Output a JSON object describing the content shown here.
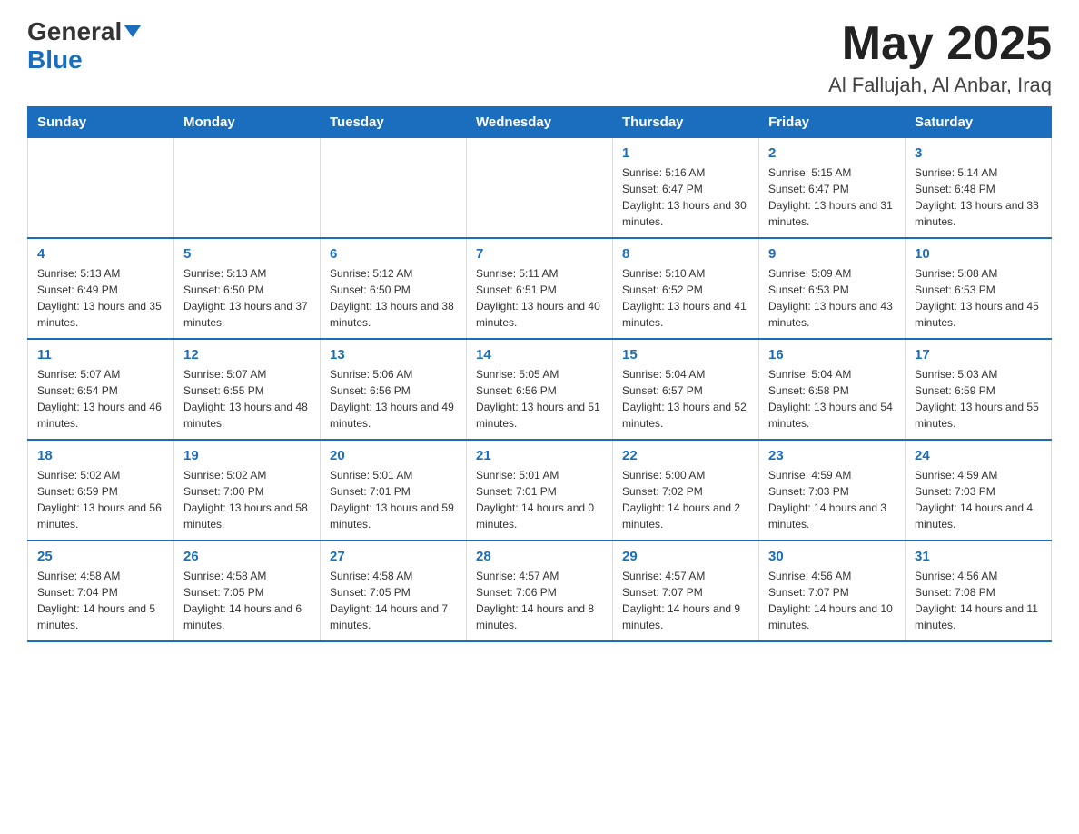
{
  "logo": {
    "text_general": "General",
    "text_blue": "Blue"
  },
  "title": {
    "month_year": "May 2025",
    "location": "Al Fallujah, Al Anbar, Iraq"
  },
  "days_of_week": [
    "Sunday",
    "Monday",
    "Tuesday",
    "Wednesday",
    "Thursday",
    "Friday",
    "Saturday"
  ],
  "weeks": [
    [
      {
        "day": "",
        "info": ""
      },
      {
        "day": "",
        "info": ""
      },
      {
        "day": "",
        "info": ""
      },
      {
        "day": "",
        "info": ""
      },
      {
        "day": "1",
        "info": "Sunrise: 5:16 AM\nSunset: 6:47 PM\nDaylight: 13 hours and 30 minutes."
      },
      {
        "day": "2",
        "info": "Sunrise: 5:15 AM\nSunset: 6:47 PM\nDaylight: 13 hours and 31 minutes."
      },
      {
        "day": "3",
        "info": "Sunrise: 5:14 AM\nSunset: 6:48 PM\nDaylight: 13 hours and 33 minutes."
      }
    ],
    [
      {
        "day": "4",
        "info": "Sunrise: 5:13 AM\nSunset: 6:49 PM\nDaylight: 13 hours and 35 minutes."
      },
      {
        "day": "5",
        "info": "Sunrise: 5:13 AM\nSunset: 6:50 PM\nDaylight: 13 hours and 37 minutes."
      },
      {
        "day": "6",
        "info": "Sunrise: 5:12 AM\nSunset: 6:50 PM\nDaylight: 13 hours and 38 minutes."
      },
      {
        "day": "7",
        "info": "Sunrise: 5:11 AM\nSunset: 6:51 PM\nDaylight: 13 hours and 40 minutes."
      },
      {
        "day": "8",
        "info": "Sunrise: 5:10 AM\nSunset: 6:52 PM\nDaylight: 13 hours and 41 minutes."
      },
      {
        "day": "9",
        "info": "Sunrise: 5:09 AM\nSunset: 6:53 PM\nDaylight: 13 hours and 43 minutes."
      },
      {
        "day": "10",
        "info": "Sunrise: 5:08 AM\nSunset: 6:53 PM\nDaylight: 13 hours and 45 minutes."
      }
    ],
    [
      {
        "day": "11",
        "info": "Sunrise: 5:07 AM\nSunset: 6:54 PM\nDaylight: 13 hours and 46 minutes."
      },
      {
        "day": "12",
        "info": "Sunrise: 5:07 AM\nSunset: 6:55 PM\nDaylight: 13 hours and 48 minutes."
      },
      {
        "day": "13",
        "info": "Sunrise: 5:06 AM\nSunset: 6:56 PM\nDaylight: 13 hours and 49 minutes."
      },
      {
        "day": "14",
        "info": "Sunrise: 5:05 AM\nSunset: 6:56 PM\nDaylight: 13 hours and 51 minutes."
      },
      {
        "day": "15",
        "info": "Sunrise: 5:04 AM\nSunset: 6:57 PM\nDaylight: 13 hours and 52 minutes."
      },
      {
        "day": "16",
        "info": "Sunrise: 5:04 AM\nSunset: 6:58 PM\nDaylight: 13 hours and 54 minutes."
      },
      {
        "day": "17",
        "info": "Sunrise: 5:03 AM\nSunset: 6:59 PM\nDaylight: 13 hours and 55 minutes."
      }
    ],
    [
      {
        "day": "18",
        "info": "Sunrise: 5:02 AM\nSunset: 6:59 PM\nDaylight: 13 hours and 56 minutes."
      },
      {
        "day": "19",
        "info": "Sunrise: 5:02 AM\nSunset: 7:00 PM\nDaylight: 13 hours and 58 minutes."
      },
      {
        "day": "20",
        "info": "Sunrise: 5:01 AM\nSunset: 7:01 PM\nDaylight: 13 hours and 59 minutes."
      },
      {
        "day": "21",
        "info": "Sunrise: 5:01 AM\nSunset: 7:01 PM\nDaylight: 14 hours and 0 minutes."
      },
      {
        "day": "22",
        "info": "Sunrise: 5:00 AM\nSunset: 7:02 PM\nDaylight: 14 hours and 2 minutes."
      },
      {
        "day": "23",
        "info": "Sunrise: 4:59 AM\nSunset: 7:03 PM\nDaylight: 14 hours and 3 minutes."
      },
      {
        "day": "24",
        "info": "Sunrise: 4:59 AM\nSunset: 7:03 PM\nDaylight: 14 hours and 4 minutes."
      }
    ],
    [
      {
        "day": "25",
        "info": "Sunrise: 4:58 AM\nSunset: 7:04 PM\nDaylight: 14 hours and 5 minutes."
      },
      {
        "day": "26",
        "info": "Sunrise: 4:58 AM\nSunset: 7:05 PM\nDaylight: 14 hours and 6 minutes."
      },
      {
        "day": "27",
        "info": "Sunrise: 4:58 AM\nSunset: 7:05 PM\nDaylight: 14 hours and 7 minutes."
      },
      {
        "day": "28",
        "info": "Sunrise: 4:57 AM\nSunset: 7:06 PM\nDaylight: 14 hours and 8 minutes."
      },
      {
        "day": "29",
        "info": "Sunrise: 4:57 AM\nSunset: 7:07 PM\nDaylight: 14 hours and 9 minutes."
      },
      {
        "day": "30",
        "info": "Sunrise: 4:56 AM\nSunset: 7:07 PM\nDaylight: 14 hours and 10 minutes."
      },
      {
        "day": "31",
        "info": "Sunrise: 4:56 AM\nSunset: 7:08 PM\nDaylight: 14 hours and 11 minutes."
      }
    ]
  ]
}
